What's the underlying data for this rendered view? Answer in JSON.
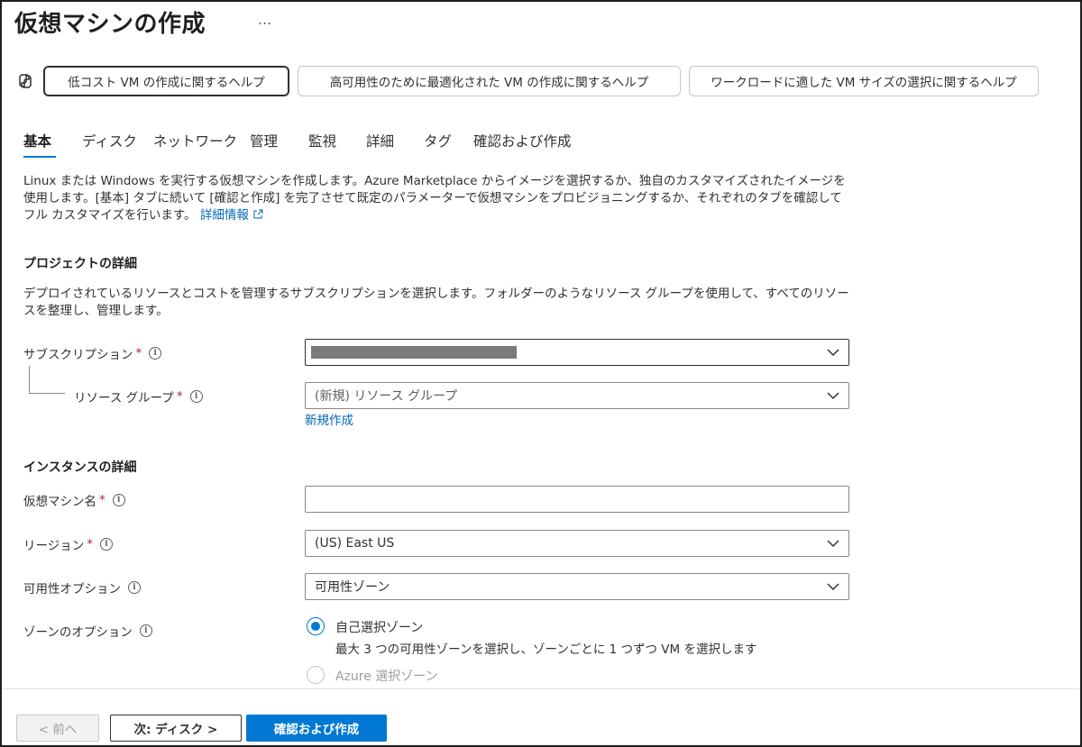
{
  "header": {
    "title": "仮想マシンの作成",
    "more": "..."
  },
  "help_buttons": [
    {
      "label": "低コスト VM の作成に関するヘルプ"
    },
    {
      "label": "高可用性のために最適化された VM の作成に関するヘルプ"
    },
    {
      "label": "ワークロードに適した VM サイズの選択に関するヘルプ"
    }
  ],
  "tabs": [
    {
      "label": "基本",
      "active": true
    },
    {
      "label": "ディスク"
    },
    {
      "label": "ネットワーク"
    },
    {
      "label": "管理"
    },
    {
      "label": "監視"
    },
    {
      "label": "詳細"
    },
    {
      "label": "タグ"
    },
    {
      "label": "確認および作成"
    }
  ],
  "intro": {
    "text": "Linux または Windows を実行する仮想マシンを作成します。Azure Marketplace からイメージを選択するか、独自のカスタマイズされたイメージを使用します。[基本] タブに続いて [確認と作成] を完了させて既定のパラメーターで仮想マシンをプロビジョニングするか、それぞれのタブを確認してフル カスタマイズを行います。",
    "link": "詳細情報"
  },
  "project": {
    "title": "プロジェクトの詳細",
    "desc": "デプロイされているリソースとコストを管理するサブスクリプションを選択します。フォルダーのようなリソース グループを使用して、すべてのリソースを整理し、管理します。",
    "subscription_label": "サブスクリプション",
    "resource_group_label": "リソース グループ",
    "resource_group_value": "(新規) リソース グループ",
    "new_link": "新規作成"
  },
  "instance": {
    "title": "インスタンスの詳細",
    "vm_name_label": "仮想マシン名",
    "vm_name_value": "",
    "region_label": "リージョン",
    "region_value": "(US) East US",
    "availability_label": "可用性オプション",
    "availability_value": "可用性ゾーン",
    "zone_label": "ゾーンのオプション",
    "zone_option1": "自己選択ゾーン",
    "zone_option1_desc": "最大 3 つの可用性ゾーンを選択し、ゾーンごとに 1 つずつ VM を選択します",
    "zone_option2": "Azure 選択ゾーン"
  },
  "footer": {
    "prev": "< 前へ",
    "next": "次: ディスク >",
    "create": "確認および作成"
  },
  "colors": {
    "accent": "#0078d4",
    "required": "#a4262c",
    "link": "#0067b8"
  }
}
